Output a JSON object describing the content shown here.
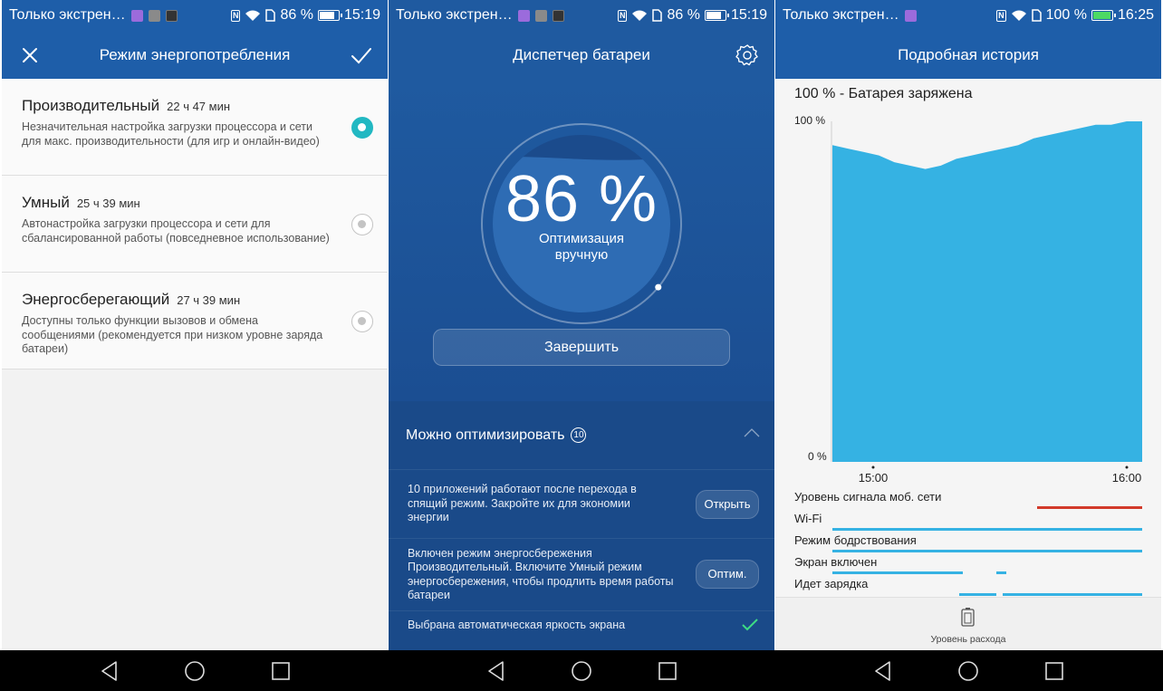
{
  "status_bars": [
    {
      "carrier": "Только экстрен…",
      "battery_text": "86 %",
      "battery_level": 0.86,
      "time": "15:19"
    },
    {
      "carrier": "Только экстрен…",
      "battery_text": "86 %",
      "battery_level": 0.86,
      "time": "15:19"
    },
    {
      "carrier": "Только экстрен…",
      "battery_text": "100 %",
      "battery_level": 1.0,
      "time": "16:25"
    }
  ],
  "power_mode": {
    "title": "Режим энергопотребления",
    "modes": [
      {
        "title": "Производительный",
        "time": "22 ч 47 мин",
        "desc": "Незначительная настройка загрузки процессора и сети для макс. производительности (для игр и онлайн-видео)",
        "selected": true
      },
      {
        "title": "Умный",
        "time": "25 ч 39 мин",
        "desc": "Автонастройка загрузки процессора и сети для сбалансированной работы (повседневное использование)",
        "selected": false
      },
      {
        "title": "Энергосберегающий",
        "time": "27 ч 39 мин",
        "desc": "Доступны только функции вызовов и обмена сообщениями (рекомендуется при низком уровне заряда батареи)",
        "selected": false
      }
    ]
  },
  "battery_manager": {
    "title": "Диспетчер батареи",
    "percent_text": "86 %",
    "level": 0.86,
    "label_line1": "Оптимизация",
    "label_line2": "вручную",
    "finish_label": "Завершить",
    "optimize_title": "Можно оптимизировать",
    "optimize_count": "10",
    "items": [
      {
        "text": "10 приложений работают после перехода в спящий режим. Закройте их для экономии энергии",
        "button": "Открыть"
      },
      {
        "text": "Включен режим энергосбережения Производительный. Включите Умный режим энергосбережения, чтобы продлить время работы батареи",
        "button": "Оптим."
      },
      {
        "text": "Выбрана автоматическая яркость экрана",
        "button": ""
      }
    ]
  },
  "history": {
    "title": "Подробная история",
    "heading": "100 % - Батарея заряжена",
    "bottom_label": "Уровень расхода",
    "chart_data": {
      "type": "area",
      "x": [
        0,
        5,
        10,
        15,
        20,
        25,
        30,
        35,
        40,
        45,
        50,
        55,
        60,
        65,
        70,
        75,
        80,
        85,
        90,
        95,
        100
      ],
      "y": [
        93,
        92,
        91,
        90,
        88,
        87,
        86,
        87,
        89,
        90,
        91,
        92,
        93,
        95,
        96,
        97,
        98,
        99,
        99,
        100,
        100
      ],
      "x_ticks": [
        "15:00",
        "16:00"
      ],
      "y_ticks": [
        "100 %",
        "0 %"
      ],
      "ylim": [
        0,
        100
      ],
      "color": "#35b2e3"
    },
    "tracks": [
      {
        "label": "Уровень сигнала моб. сети",
        "color": "#d23a2a",
        "segments": [
          [
            0.66,
            1.0
          ]
        ]
      },
      {
        "label": "Wi-Fi",
        "color": "#35b2e3",
        "segments": [
          [
            0.0,
            1.0
          ]
        ]
      },
      {
        "label": "Режим бодрствования",
        "color": "#35b2e3",
        "segments": [
          [
            0.0,
            1.0
          ]
        ]
      },
      {
        "label": "Экран включен",
        "color": "#35b2e3",
        "segments": [
          [
            0.0,
            0.42
          ],
          [
            0.53,
            0.56
          ]
        ]
      },
      {
        "label": "Идет зарядка",
        "color": "#35b2e3",
        "segments": [
          [
            0.41,
            0.53
          ],
          [
            0.55,
            1.0
          ]
        ]
      }
    ]
  }
}
